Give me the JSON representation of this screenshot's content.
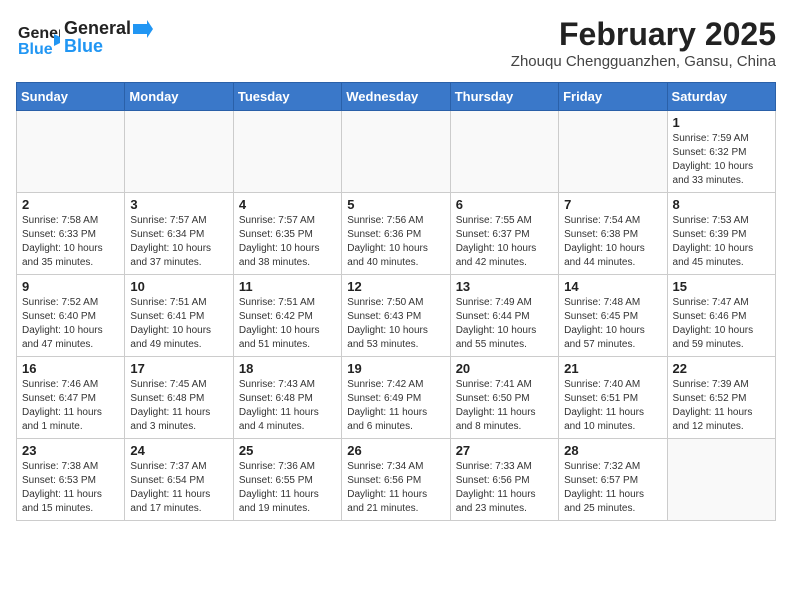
{
  "header": {
    "logo_general": "General",
    "logo_blue": "Blue",
    "month_year": "February 2025",
    "location": "Zhouqu Chengguanzhen, Gansu, China"
  },
  "days_of_week": [
    "Sunday",
    "Monday",
    "Tuesday",
    "Wednesday",
    "Thursday",
    "Friday",
    "Saturday"
  ],
  "weeks": [
    [
      {
        "day": "",
        "info": ""
      },
      {
        "day": "",
        "info": ""
      },
      {
        "day": "",
        "info": ""
      },
      {
        "day": "",
        "info": ""
      },
      {
        "day": "",
        "info": ""
      },
      {
        "day": "",
        "info": ""
      },
      {
        "day": "1",
        "info": "Sunrise: 7:59 AM\nSunset: 6:32 PM\nDaylight: 10 hours and 33 minutes."
      }
    ],
    [
      {
        "day": "2",
        "info": "Sunrise: 7:58 AM\nSunset: 6:33 PM\nDaylight: 10 hours and 35 minutes."
      },
      {
        "day": "3",
        "info": "Sunrise: 7:57 AM\nSunset: 6:34 PM\nDaylight: 10 hours and 37 minutes."
      },
      {
        "day": "4",
        "info": "Sunrise: 7:57 AM\nSunset: 6:35 PM\nDaylight: 10 hours and 38 minutes."
      },
      {
        "day": "5",
        "info": "Sunrise: 7:56 AM\nSunset: 6:36 PM\nDaylight: 10 hours and 40 minutes."
      },
      {
        "day": "6",
        "info": "Sunrise: 7:55 AM\nSunset: 6:37 PM\nDaylight: 10 hours and 42 minutes."
      },
      {
        "day": "7",
        "info": "Sunrise: 7:54 AM\nSunset: 6:38 PM\nDaylight: 10 hours and 44 minutes."
      },
      {
        "day": "8",
        "info": "Sunrise: 7:53 AM\nSunset: 6:39 PM\nDaylight: 10 hours and 45 minutes."
      }
    ],
    [
      {
        "day": "9",
        "info": "Sunrise: 7:52 AM\nSunset: 6:40 PM\nDaylight: 10 hours and 47 minutes."
      },
      {
        "day": "10",
        "info": "Sunrise: 7:51 AM\nSunset: 6:41 PM\nDaylight: 10 hours and 49 minutes."
      },
      {
        "day": "11",
        "info": "Sunrise: 7:51 AM\nSunset: 6:42 PM\nDaylight: 10 hours and 51 minutes."
      },
      {
        "day": "12",
        "info": "Sunrise: 7:50 AM\nSunset: 6:43 PM\nDaylight: 10 hours and 53 minutes."
      },
      {
        "day": "13",
        "info": "Sunrise: 7:49 AM\nSunset: 6:44 PM\nDaylight: 10 hours and 55 minutes."
      },
      {
        "day": "14",
        "info": "Sunrise: 7:48 AM\nSunset: 6:45 PM\nDaylight: 10 hours and 57 minutes."
      },
      {
        "day": "15",
        "info": "Sunrise: 7:47 AM\nSunset: 6:46 PM\nDaylight: 10 hours and 59 minutes."
      }
    ],
    [
      {
        "day": "16",
        "info": "Sunrise: 7:46 AM\nSunset: 6:47 PM\nDaylight: 11 hours and 1 minute."
      },
      {
        "day": "17",
        "info": "Sunrise: 7:45 AM\nSunset: 6:48 PM\nDaylight: 11 hours and 3 minutes."
      },
      {
        "day": "18",
        "info": "Sunrise: 7:43 AM\nSunset: 6:48 PM\nDaylight: 11 hours and 4 minutes."
      },
      {
        "day": "19",
        "info": "Sunrise: 7:42 AM\nSunset: 6:49 PM\nDaylight: 11 hours and 6 minutes."
      },
      {
        "day": "20",
        "info": "Sunrise: 7:41 AM\nSunset: 6:50 PM\nDaylight: 11 hours and 8 minutes."
      },
      {
        "day": "21",
        "info": "Sunrise: 7:40 AM\nSunset: 6:51 PM\nDaylight: 11 hours and 10 minutes."
      },
      {
        "day": "22",
        "info": "Sunrise: 7:39 AM\nSunset: 6:52 PM\nDaylight: 11 hours and 12 minutes."
      }
    ],
    [
      {
        "day": "23",
        "info": "Sunrise: 7:38 AM\nSunset: 6:53 PM\nDaylight: 11 hours and 15 minutes."
      },
      {
        "day": "24",
        "info": "Sunrise: 7:37 AM\nSunset: 6:54 PM\nDaylight: 11 hours and 17 minutes."
      },
      {
        "day": "25",
        "info": "Sunrise: 7:36 AM\nSunset: 6:55 PM\nDaylight: 11 hours and 19 minutes."
      },
      {
        "day": "26",
        "info": "Sunrise: 7:34 AM\nSunset: 6:56 PM\nDaylight: 11 hours and 21 minutes."
      },
      {
        "day": "27",
        "info": "Sunrise: 7:33 AM\nSunset: 6:56 PM\nDaylight: 11 hours and 23 minutes."
      },
      {
        "day": "28",
        "info": "Sunrise: 7:32 AM\nSunset: 6:57 PM\nDaylight: 11 hours and 25 minutes."
      },
      {
        "day": "",
        "info": ""
      }
    ]
  ]
}
